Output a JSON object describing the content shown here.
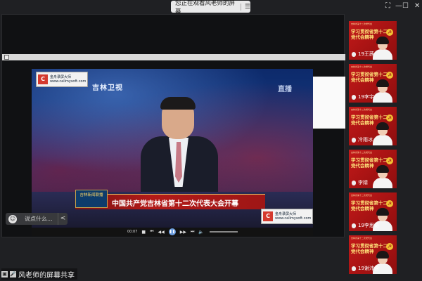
{
  "window": {
    "title": "您正在观看风老师的屏幕",
    "menu_icon": "menu-icon",
    "controls": {
      "fullscreen": "⛶",
      "minimize": "—",
      "maximize": "☐",
      "close": "✕"
    }
  },
  "video": {
    "watermark_top": {
      "line1": "金舟录屏大师",
      "line2": "www.callmysoft.com"
    },
    "channel": "吉林卫视",
    "live_tag": "直播",
    "news_tag": "吉林新闻联播",
    "headline": "中国共产党吉林省第十二次代表大会开幕",
    "watermark_bottom": {
      "line1": "金舟录屏大师",
      "line2": "www.callmysoft.com"
    }
  },
  "player": {
    "time": "00:07"
  },
  "comment": {
    "placeholder": "说点什么...",
    "collapse": "<"
  },
  "bottom_label": "风老师的屏幕共享",
  "participants": [
    {
      "name": "19王茜",
      "caption": "学习贯彻省第十二次党代会精神",
      "header": "吉林省第十二次党代会"
    },
    {
      "name": "19李宇",
      "caption": "学习贯彻省第十二次党代会精神",
      "header": "吉林省第十二次党代会"
    },
    {
      "name": "冷雨冰",
      "caption": "学习贯彻省第十二次党代会精神",
      "header": "吉林省第十二次党代会"
    },
    {
      "name": "李婧",
      "caption": "学习贯彻省第十二次党代会精神",
      "header": "吉林省第十二次党代会"
    },
    {
      "name": "19李思奇",
      "caption": "学习贯彻省第十二次党代会精神",
      "header": "吉林省第十二次党代会"
    },
    {
      "name": "19谢沛含",
      "caption": "学习贯彻省第十二次党代会精神",
      "header": "吉林省第十二次党代会"
    }
  ],
  "colors": {
    "tile_red": "#b81616",
    "caption_yellow": "#ffe27a",
    "background": "#1f2023"
  }
}
